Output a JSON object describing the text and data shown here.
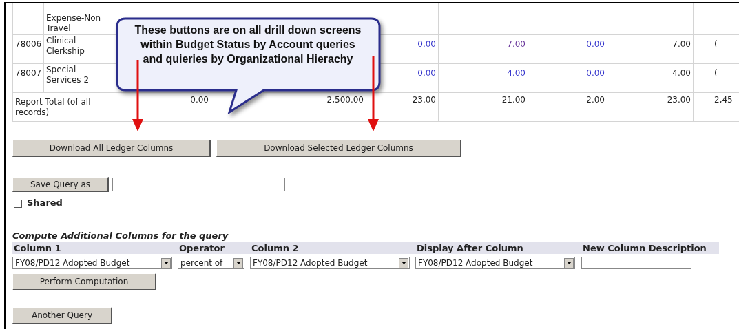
{
  "table": {
    "rows": [
      {
        "name": "Expense-Non Travel",
        "cells": [
          null,
          null,
          null,
          null,
          null,
          null,
          null,
          null
        ]
      },
      {
        "code": "78006",
        "name": "Clinical Clerkship",
        "cells": [
          null,
          null,
          null,
          {
            "text": "0.00",
            "kind": "link"
          },
          {
            "text": "7.00",
            "kind": "visited"
          },
          {
            "text": "0.00",
            "kind": "link"
          },
          {
            "text": "7.00",
            "kind": "plain"
          },
          {
            "text": "(",
            "kind": "plain"
          }
        ]
      },
      {
        "code": "78007",
        "name": "Special Services 2",
        "cells": [
          null,
          null,
          null,
          {
            "text": "0.00",
            "kind": "link"
          },
          {
            "text": "4.00",
            "kind": "link"
          },
          {
            "text": "0.00",
            "kind": "link"
          },
          {
            "text": "4.00",
            "kind": "plain"
          },
          {
            "text": "(",
            "kind": "plain"
          }
        ]
      }
    ],
    "total": {
      "label": "Report Total (of all records)",
      "cells": [
        "0.00",
        null,
        "2,500.00",
        "23.00",
        "21.00",
        "2.00",
        "23.00",
        "2,45"
      ]
    }
  },
  "callout": {
    "text": "These buttons are on all drill down screens within Budget Status by Account queries and quieries by Organizational Hierachy"
  },
  "download_buttons": [
    "Download All Ledger Columns",
    "Download Selected Ledger Columns"
  ],
  "save_query": {
    "button": "Save Query as",
    "shared": {
      "label": "Shared",
      "checked": false
    }
  },
  "compute": {
    "title": "Compute Additional Columns for the query",
    "headers": [
      "Column 1",
      "Operator",
      "Column 2",
      "Display After Column",
      "New Column Description"
    ],
    "selects": [
      "FY08/PD12 Adopted Budget",
      "percent of",
      "FY08/PD12 Adopted Budget",
      "FY08/PD12 Adopted Budget"
    ],
    "button": "Perform Computation"
  },
  "another_query": "Another Query"
}
